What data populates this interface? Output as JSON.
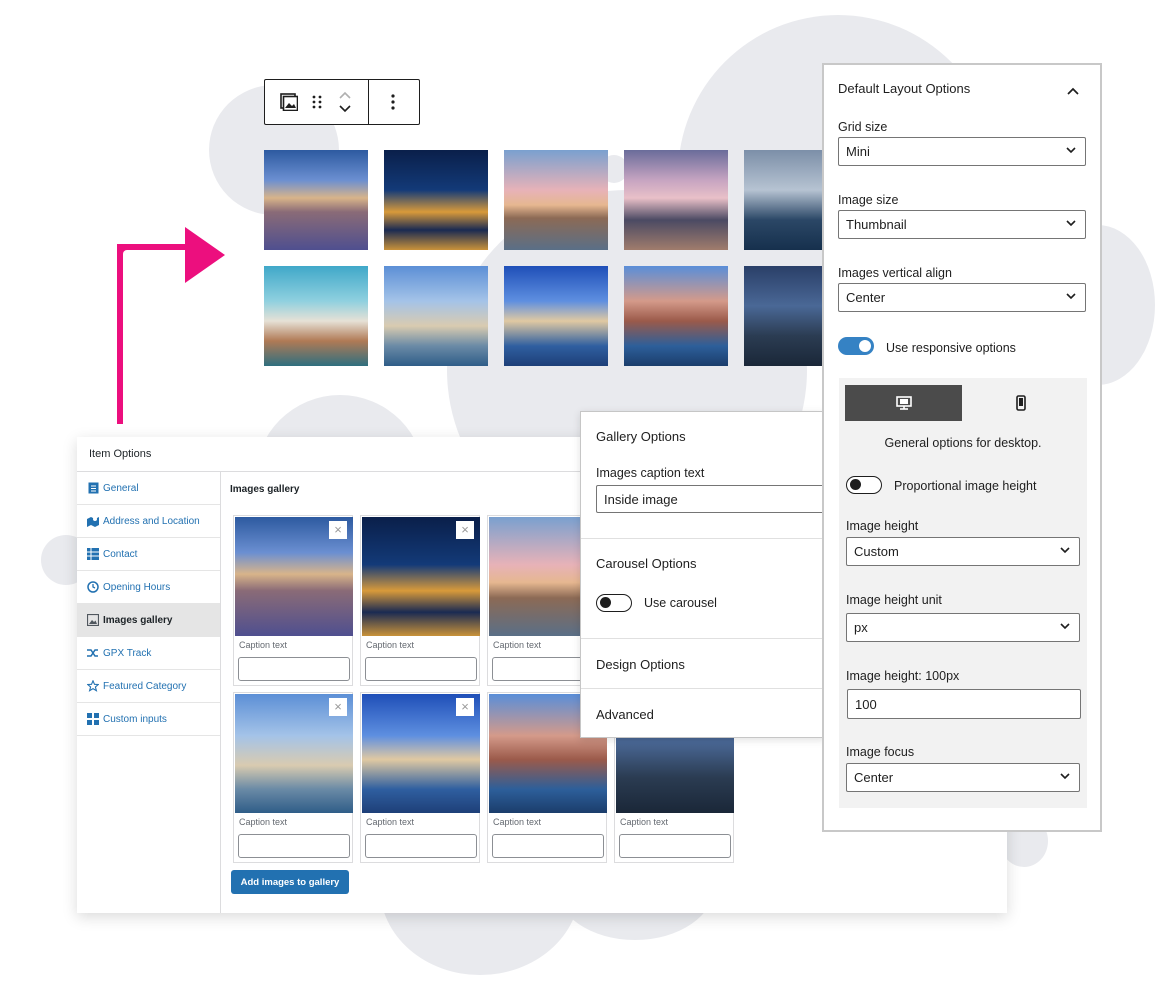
{
  "toolbar": {
    "icons": [
      "gallery-block-icon",
      "drag-handle-icon",
      "move-up-icon",
      "move-down-icon",
      "more-options-icon"
    ]
  },
  "preview_gallery": {
    "images": [
      "Venice square",
      "Grand Canal night",
      "Island at dusk",
      "Catamaran on beach",
      "Sailboat at sea",
      "Rialto bridge",
      "Salute basilica",
      "Canal view",
      "Colorful canal",
      "Lighthouse"
    ]
  },
  "item_options": {
    "title": "Item Options",
    "nav": [
      {
        "label": "General",
        "icon": "document-icon"
      },
      {
        "label": "Address and Location",
        "icon": "map-icon"
      },
      {
        "label": "Contact",
        "icon": "contact-table-icon"
      },
      {
        "label": "Opening Hours",
        "icon": "clock-icon"
      },
      {
        "label": "Images gallery",
        "icon": "gallery-icon"
      },
      {
        "label": "GPX Track",
        "icon": "shuffle-icon"
      },
      {
        "label": "Featured Category",
        "icon": "star-icon"
      },
      {
        "label": "Custom inputs",
        "icon": "grid-icon"
      }
    ],
    "active_nav": "Images gallery",
    "section_title": "Images gallery",
    "caption_label": "Caption text",
    "remove_symbol": "×",
    "add_button": "Add images to gallery"
  },
  "gallery_options": {
    "heading": "Gallery Options",
    "caption_label": "Images caption text",
    "caption_value": "Inside image",
    "carousel_heading": "Carousel Options",
    "use_carousel_label": "Use carousel",
    "use_carousel": false,
    "design_heading": "Design Options",
    "advanced_heading": "Advanced"
  },
  "layout_options": {
    "heading": "Default Layout Options",
    "grid_size_label": "Grid size",
    "grid_size": "Mini",
    "image_size_label": "Image size",
    "image_size": "Thumbnail",
    "vertical_align_label": "Images vertical align",
    "vertical_align": "Center",
    "responsive_label": "Use responsive options",
    "responsive": true,
    "desktop_caption": "General options for desktop.",
    "proportional_label": "Proportional image height",
    "proportional": false,
    "image_height_label": "Image height",
    "image_height": "Custom",
    "image_height_unit_label": "Image height unit",
    "image_height_unit": "px",
    "image_height_value_label": "Image height: 100px",
    "image_height_value": "100",
    "image_focus_label": "Image focus",
    "image_focus": "Center"
  },
  "colors": {
    "accent_arrow": "#ec0f7e",
    "wp_blue": "#2271b1",
    "toggle_on": "#3582c4",
    "tab_active": "#4b4b4b"
  }
}
